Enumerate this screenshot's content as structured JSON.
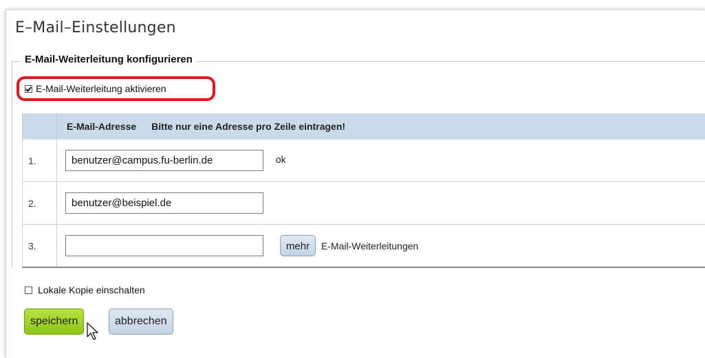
{
  "page": {
    "title": "E–Mail–Einstellungen"
  },
  "forwarding": {
    "legend": "E-Mail-Weiterleitung konfigurieren",
    "activate_label": "E-Mail-Weiterleitung aktivieren",
    "activate_checked": true,
    "table": {
      "header_address": "E-Mail-Adresse",
      "header_hint": "Bitte nur eine Adresse pro Zeile eintragen!",
      "rows": [
        {
          "num": "1.",
          "value": "benutzer@campus.fu-berlin.de",
          "status": "ok"
        },
        {
          "num": "2.",
          "value": "benutzer@beispiel.de",
          "status": ""
        },
        {
          "num": "3.",
          "value": "",
          "status": ""
        }
      ]
    },
    "more_button": "mehr",
    "more_label": "E-Mail-Weiterleitungen"
  },
  "local_copy": {
    "label": "Lokale Kopie einschalten",
    "checked": false
  },
  "actions": {
    "save_label": "speichern",
    "cancel_label": "abbrechen"
  },
  "colors": {
    "highlight": "#e8141b",
    "table_header": "#cbdaea",
    "save_button": "#9ccf22"
  }
}
